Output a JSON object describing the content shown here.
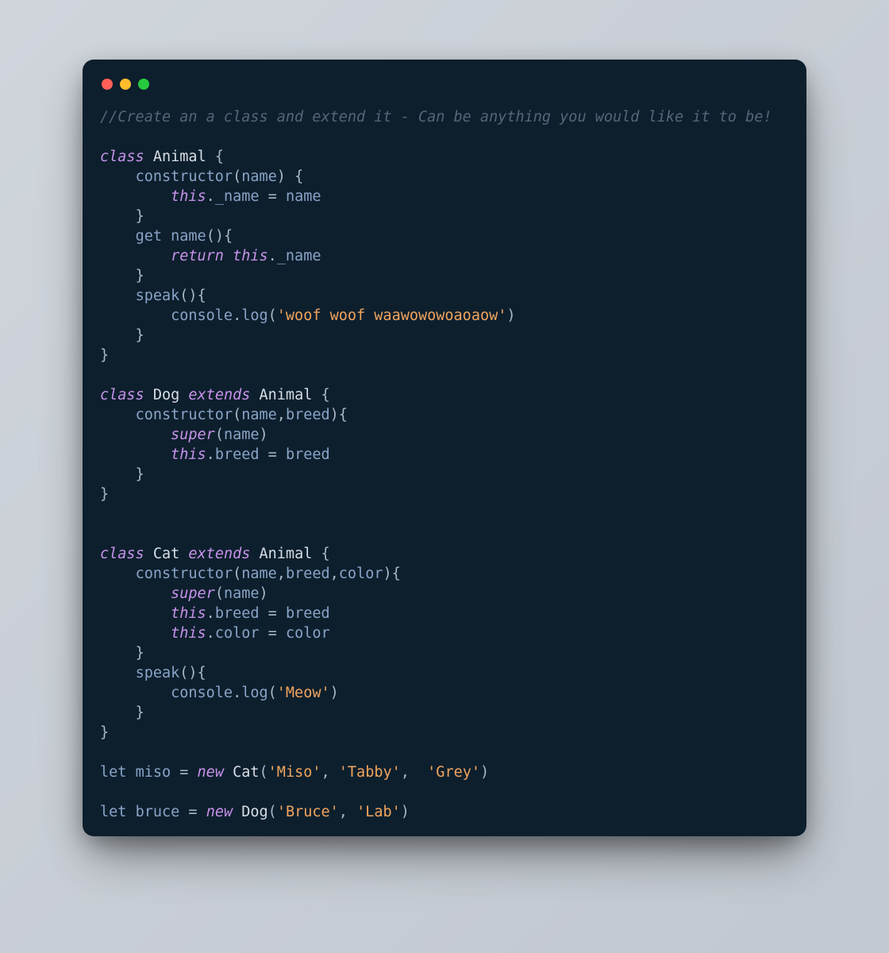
{
  "window": {
    "traffic_lights": {
      "red": "#ff5f56",
      "yellow": "#ffbd2e",
      "green": "#27c93f"
    },
    "background": "#0d1f2d"
  },
  "code": {
    "comment": "//Create an a class and extend it - Can be anything you would like it to be!",
    "kw_class": "class",
    "kw_extends": "extends",
    "kw_return": "return",
    "kw_this": "this",
    "kw_super": "super",
    "kw_new": "new",
    "kw_let": "let",
    "cls_animal": "Animal",
    "cls_dog": "Dog",
    "cls_cat": "Cat",
    "m_constructor": "constructor",
    "m_get": "get",
    "m_name": "name",
    "m_speak": "speak",
    "p_name": "name",
    "p_breed": "breed",
    "p_color": "color",
    "prop__name": "_name",
    "prop_breed": "breed",
    "prop_color": "color",
    "id_console": "console",
    "id_log": "log",
    "str_woof": "'woof woof waawowowoaoaow'",
    "str_meow": "'Meow'",
    "var_miso": "miso",
    "var_bruce": "bruce",
    "str_miso": "'Miso'",
    "str_tabby": "'Tabby'",
    "str_grey": "'Grey'",
    "str_bruce": "'Bruce'",
    "str_lab": "'Lab'",
    "sp1": " ",
    "sp2": " ",
    "ob": "{",
    "cb": "}",
    "op": "(",
    "cp": ")",
    "comma": ",",
    "comma_s": ", ",
    "comma_s2": ",  ",
    "dot": ".",
    "eq": " = "
  }
}
